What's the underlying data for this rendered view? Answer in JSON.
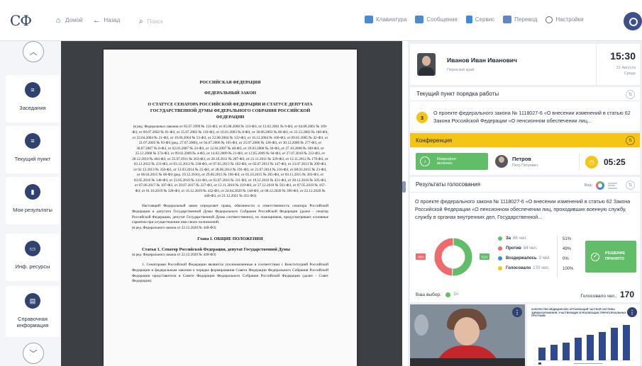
{
  "header": {
    "logo": "СФ",
    "home_label": "Домой",
    "back_label": "Назад",
    "search_placeholder": "Поиск",
    "tools": [
      {
        "label": "Клавиатура",
        "icon": "keyboard-icon"
      },
      {
        "label": "Сообщения",
        "icon": "messages-icon"
      },
      {
        "label": "Сервис",
        "icon": "service-icon"
      },
      {
        "label": "Перевод",
        "icon": "translate-icon"
      },
      {
        "label": "Настройки",
        "icon": "settings-icon"
      }
    ]
  },
  "sidebar": {
    "items": [
      {
        "label": "Заседания",
        "icon": "list-icon"
      },
      {
        "label": "Текущий пункт",
        "icon": "list-icon"
      },
      {
        "label": "Мои результаты",
        "icon": "bar-chart-icon"
      },
      {
        "label": "Инф. ресурсы",
        "icon": "window-icon"
      },
      {
        "label": "Справочная информация",
        "icon": "document-icon"
      }
    ]
  },
  "document": {
    "header1": "РОССИЙСКАЯ ФЕДЕРАЦИЯ",
    "header2": "ФЕДЕРАЛЬНЫЙ ЗАКОН",
    "title": "О СТАТУСЕ СЕНАТОРА РОССИЙСКОЙ ФЕДЕРАЦИИ И СТАТУСЕ ДЕПУТАТА ГОСУДАРСТВЕННОЙ ДУМЫ ФЕДЕРАЛЬНОГО СОБРАНИЯ РОССИЙСКОЙ ФЕДЕРАЦИИ",
    "editions": "(в ред. Федеральных законов от 05.07.1999 № 133-ФЗ, от 05.08.2000 № 113-ФЗ, от 12.02.2001 № 9-ФЗ, от 04.08.2001 № 109-ФЗ, от 09.07.2002 № 81-ФЗ, от 25.07.2002 № 116-ФЗ, от 10.01.2003 № 8-ФЗ, от 30.06.2003 № 86-ФЗ, от 23.12.2003 № 186-ФЗ, от 22.04.2004 № 21-ФЗ, от 19.06.2004 № 53-ФЗ, от 22.08.2004 № 122-ФЗ, от 16.12.2004 № 160-ФЗ, от 09.05.2005 № 42-ФЗ, от 21.07.2005 № 93-ФЗ (ред. 27.07.2006), от 04.07.2006 № 105-ФЗ, от 25.07.2006 № 128-ФЗ, от 30.12.2006 № 277-ФЗ, от 30.07.2007 № 8-ФЗ, от 02.03.2007 № 24-ФЗ, от 12.04.2007 № 48-ФЗ, от 29.03.2008 № 30-ФЗ, от 27.10.2008 № 180-ФЗ, от 25.12.2008 № 274-ФЗ, от 09.02.2009 № 4-ФЗ, от 14.02.2009 № 21-ФЗ, от 12.05.2009 № 94-ФЗ, от 27.07.2010 № 212-ФЗ, от 28.12.2010 № 404-ФЗ, от 25.07.2011 № 263-ФЗ, от 20.10.2011 № 287-ФЗ, от 21.11.2011 № 329-ФЗ, от 12.11.2012 № 178-ФЗ, от 03.12.2012 № 231-ФЗ, от 03.12.2012 № 238-ФЗ, от 07.05.2013 № 102-ФЗ, от 02.07.2013 № 147-ФЗ, от 23.07.2013 № 209-ФЗ, от 02.12.2013 № 350-ФЗ, от 12.03.2014 № 25-ФЗ, от 28.06.2014 № 191-ФЗ, от 21.07.2014 № 216-ФЗ, от 08.03.2015 № 23-ФЗ, от 06.04.2015 № 68-ФЗ (ред. 19.12.2016), от 29.06.2015 № 196-ФЗ, от 05.10.2015 № 285-ФЗ, от 03.11.2015 № 303-ФЗ, от 03.05.2016 № 140-ФЗ, от 23.05.2016 № 141-ФЗ, от 03.07.2016 № 311-ФЗ, от 19.12.2016 № 451-ФЗ, от 28.12.2016 № 505-ФЗ, от 07.06.2017 № 107-ФЗ, от 29.07.2017 № 227-ФЗ, от 12.11.2018 № 419-ФЗ, от 27.12.2018 № 561-ФЗ, от 07.05.2019 № 167-ФЗ, от 01.10.2019 № 328-ФЗ, от 16.12.2019 № 432-ФЗ, от 24.04.2020 № 148-ФЗ, от 08.12.2020 № 396-ФЗ, от 22.12.2020 № 440-ФЗ, от 21.12.2021 № 431-ФЗ)",
    "preamble": "Настоящий Федеральный закон определяет права, обязанности и ответственность сенатора Российской Федерации и депутата Государственной Думы Федерального Собрания Российской Федерации (далее - сенатор Российской Федерации, депутат Государственной Думы соответственно), их помощников, предусматривает основные гарантии при осуществлении ими своих полномочий.",
    "preamble_note": "(в ред. Федерального закона от 22.12.2020 № 440-ФЗ)",
    "chapter": "Глава I. ОБЩИЕ ПОЛОЖЕНИЯ",
    "article": "Статья 1. Сенатор Российской Федерации, депутат Государственной Думы",
    "article_note": "(в ред. Федерального закона от 22.12.2020 № 440-ФЗ)",
    "para1": "1. Сенаторами Российской Федерации являются уполномоченные в соответствии с Конституцией Российской Федерации и федеральным законом о порядке формирования Совета Федерации Федерального Собрания Российской Федерации представители в Совете Федерации Федерального Собрания Российской Федерации (далее - Совет Федерации)."
  },
  "profile": {
    "name": "Иванов Иван Иванович",
    "region": "Пермский край",
    "time": "15:30",
    "date": "31 Августа",
    "weekday": "Среда"
  },
  "agenda": {
    "title": "Текущий пункт порядка работы",
    "number": "3",
    "text": "О проекте федерального закона № 1118027-6 «О внесении изменений в статью 62 Закона Российской Федерации «О пенсионном обеспечении лиц..."
  },
  "conference": {
    "title": "Конференция",
    "mic_label_1": "Микрофон",
    "mic_label_2": "включен",
    "speaker_name": "Петров",
    "speaker_sub": "Петр Петрович",
    "timer": "05:25"
  },
  "results": {
    "title": "Результаты голосования",
    "view_label": "Вид:",
    "question": "О проекте федерального закона № 1118027-6 «О внесении изменений в статью 62 Закона Российской Федерации «О пенсионном обеспечении лиц, проходивших военную службу, службу в органах внутренних дел, Государственной...",
    "rows": [
      {
        "label": "За",
        "count": "86 чел.",
        "pct": "51%",
        "color": "#62bd69"
      },
      {
        "label": "Против",
        "count": "84 чел.",
        "pct": "49%",
        "color": "#ee6b6b"
      },
      {
        "label": "Воздержалось",
        "count": "0 чел.",
        "pct": "0%",
        "color": "#3d8be0"
      },
      {
        "label": "Голосовало",
        "count": "170 чел.",
        "pct": "100%",
        "color": "#f5c515"
      }
    ],
    "pie_left_label": "49%",
    "pie_right_label": "51%",
    "decision_1": "РЕШЕНИЕ",
    "decision_2": "ПРИНЯТО",
    "my_choice_label": "Ваш выбор:",
    "my_choice": "ЗА",
    "voted_label": "Голосовало чел.:",
    "voted_total": "170"
  },
  "slide": {
    "title": "КОЛИЧЕСТВО МЕДИЦИНСКИХ ОРГАНИЗАЦИЙ ЧАСТНОЙ СИСТЕМЫ ЗДРАВООХРАНЕНИЯ, УЧАСТВУЮЩИХ В РЕАЛИЗАЦИИ ТЕРРИТОРИАЛЬНЫХ ПРОГРАММ"
  },
  "chart_data": {
    "type": "pie",
    "categories": [
      "За",
      "Против",
      "Воздержалось"
    ],
    "values": [
      51,
      49,
      0
    ],
    "colors": [
      "#62bd69",
      "#ee6b6b",
      "#3d8be0"
    ]
  }
}
